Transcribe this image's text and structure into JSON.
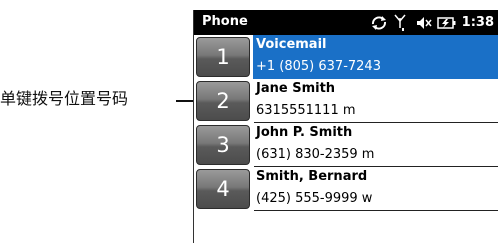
{
  "annotation": {
    "label": "单键拨号位置号码"
  },
  "status_bar": {
    "title": "Phone",
    "time": "1:38",
    "icons": [
      "sync-icon",
      "signal-icon",
      "volume-muted-icon",
      "battery-charging-icon"
    ]
  },
  "speed_dial": {
    "entries": [
      {
        "key": "1",
        "name": "Voicemail",
        "number": "+1 (805) 637-7243",
        "selected": true
      },
      {
        "key": "2",
        "name": "Jane Smith",
        "number": "6315551111 m",
        "selected": false
      },
      {
        "key": "3",
        "name": "John P. Smith",
        "number": "(631) 830-2359 m",
        "selected": false
      },
      {
        "key": "4",
        "name": "Smith, Bernard",
        "number": "(425) 555-9999 w",
        "selected": false
      }
    ]
  },
  "colors": {
    "status_bar_bg": "#000000",
    "selection": "#1a70c7",
    "key_gray": "#6e6e6e"
  }
}
